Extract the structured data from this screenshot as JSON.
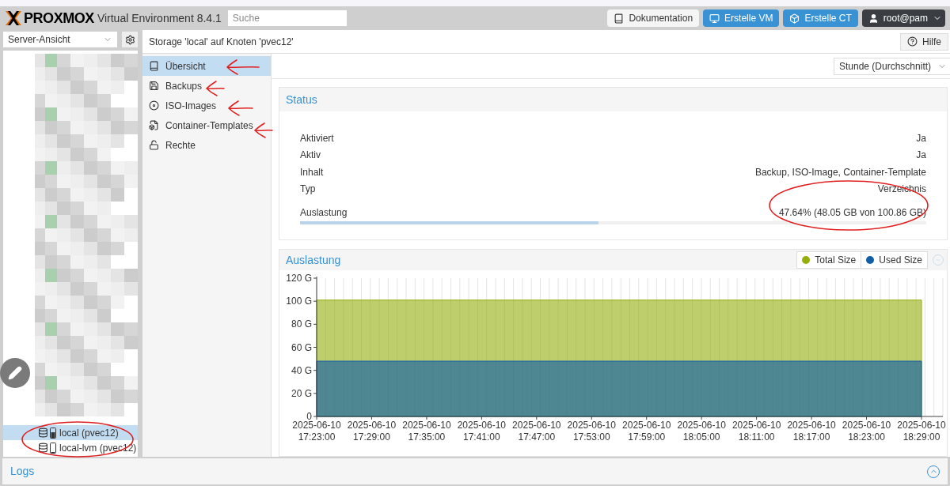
{
  "header": {
    "logo": "PROXMOX",
    "product": "Virtual Environment 8.4.1",
    "search": {
      "placeholder": "Suche"
    },
    "buttons": [
      {
        "label": "Dokumentation",
        "kind": "plain"
      },
      {
        "label": "Erstelle VM",
        "kind": "primary"
      },
      {
        "label": "Erstelle CT",
        "kind": "primary"
      }
    ],
    "user": "root@pam"
  },
  "sidebar": {
    "view": "Server-Ansicht",
    "items": [
      {
        "label": "local (pvec12)",
        "selected": true
      },
      {
        "label": "local-lvm (pvec12)",
        "selected": false
      }
    ]
  },
  "title": "Storage 'local' auf Knoten 'pvec12'",
  "help": "Hilfe",
  "menu": [
    {
      "label": "Übersicht",
      "selected": true
    },
    {
      "label": "Backups",
      "selected": false
    },
    {
      "label": "ISO-Images",
      "selected": false
    },
    {
      "label": "Container-Templates",
      "selected": false
    },
    {
      "label": "Rechte",
      "selected": false
    }
  ],
  "timeframe": "Stunde (Durchschnitt)",
  "status": {
    "title": "Status",
    "rows": [
      {
        "label": "Aktiviert",
        "value": "Ja"
      },
      {
        "label": "Aktiv",
        "value": "Ja"
      },
      {
        "label": "Inhalt",
        "value": "Backup, ISO-Image, Container-Template"
      },
      {
        "label": "Typ",
        "value": "Verzeichnis"
      }
    ],
    "usage": {
      "label": "Auslastung",
      "value": "47.64% (48.05 GB von 100.86 GB)",
      "level": 0.4764
    }
  },
  "chart_panel": {
    "title": "Auslastung",
    "chart_data": {
      "type": "area",
      "categories": [
        "2025-06-10 17:23:00",
        "2025-06-10 17:29:00",
        "2025-06-10 17:35:00",
        "2025-06-10 17:41:00",
        "2025-06-10 17:47:00",
        "2025-06-10 17:53:00",
        "2025-06-10 17:59:00",
        "2025-06-10 18:05:00",
        "2025-06-10 18:11:00",
        "2025-06-10 18:17:00",
        "2025-06-10 18:23:00",
        "2025-06-10 18:29:00"
      ],
      "series": [
        {
          "name": "Total Size",
          "color": "#94ae0a",
          "values": [
            101,
            101,
            101,
            101,
            101,
            101,
            101,
            101,
            101,
            101,
            101,
            101
          ]
        },
        {
          "name": "Used Size",
          "color": "#115fa6",
          "values": [
            48,
            48,
            48,
            48,
            48,
            48,
            48,
            48,
            48,
            48,
            48,
            48
          ]
        }
      ],
      "grid": true,
      "ylim": [
        0,
        120
      ],
      "yticks": [
        {
          "value": 0,
          "label": "0"
        },
        {
          "value": 20,
          "label": "20 G"
        },
        {
          "value": 40,
          "label": "40 G"
        },
        {
          "value": 60,
          "label": "60 G"
        },
        {
          "value": 80,
          "label": "80 G"
        },
        {
          "value": 100,
          "label": "100 G"
        },
        {
          "value": 120,
          "label": "120 G"
        }
      ]
    }
  },
  "logs": "Logs"
}
